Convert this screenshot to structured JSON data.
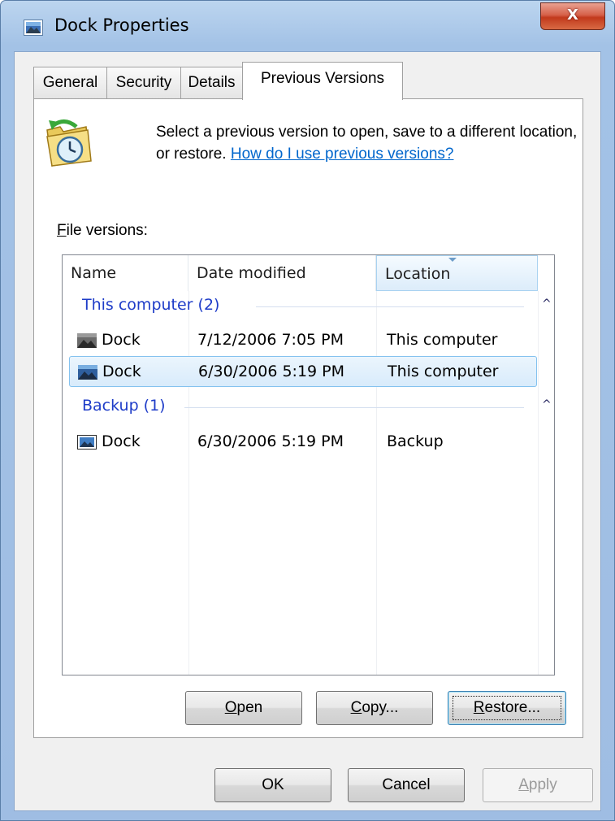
{
  "window": {
    "title": "Dock Properties",
    "close_glyph": "X"
  },
  "tabs": [
    {
      "label": "General"
    },
    {
      "label": "Security"
    },
    {
      "label": "Details"
    },
    {
      "label": "Previous Versions"
    }
  ],
  "intro": {
    "text": "Select a previous version to open, save to a different location, or restore.",
    "link": "How do I use previous versions?"
  },
  "file_versions_label": {
    "hotkey": "F",
    "rest": "ile versions:"
  },
  "columns": [
    "Name",
    "Date modified",
    "Location"
  ],
  "groups": [
    {
      "title": "This computer (2)",
      "collapse_glyph": "^",
      "rows": [
        {
          "name": "Dock",
          "date": "7/12/2006 7:05 PM",
          "location": "This computer",
          "selected": false
        },
        {
          "name": "Dock",
          "date": "6/30/2006 5:19 PM",
          "location": "This computer",
          "selected": true
        }
      ]
    },
    {
      "title": "Backup (1)",
      "collapse_glyph": "^",
      "rows": [
        {
          "name": "Dock",
          "date": "6/30/2006 5:19 PM",
          "location": "Backup",
          "selected": false
        }
      ]
    }
  ],
  "action_buttons": {
    "open": {
      "hotkey": "O",
      "rest": "pen"
    },
    "copy": {
      "hotkey": "C",
      "rest": "opy..."
    },
    "restore": {
      "hotkey": "R",
      "rest": "estore..."
    }
  },
  "dialog_buttons": {
    "ok": "OK",
    "cancel": "Cancel",
    "apply": {
      "hotkey": "A",
      "rest": "pply"
    }
  },
  "icons": {
    "app": "image-file-icon",
    "folder": "previous-versions-folder-icon",
    "file": "image-file-icon"
  },
  "colors": {
    "link": "#0066cc",
    "group_title": "#1e3cc8",
    "selection": "#d8ebfb",
    "close_button": "#c2391c"
  }
}
